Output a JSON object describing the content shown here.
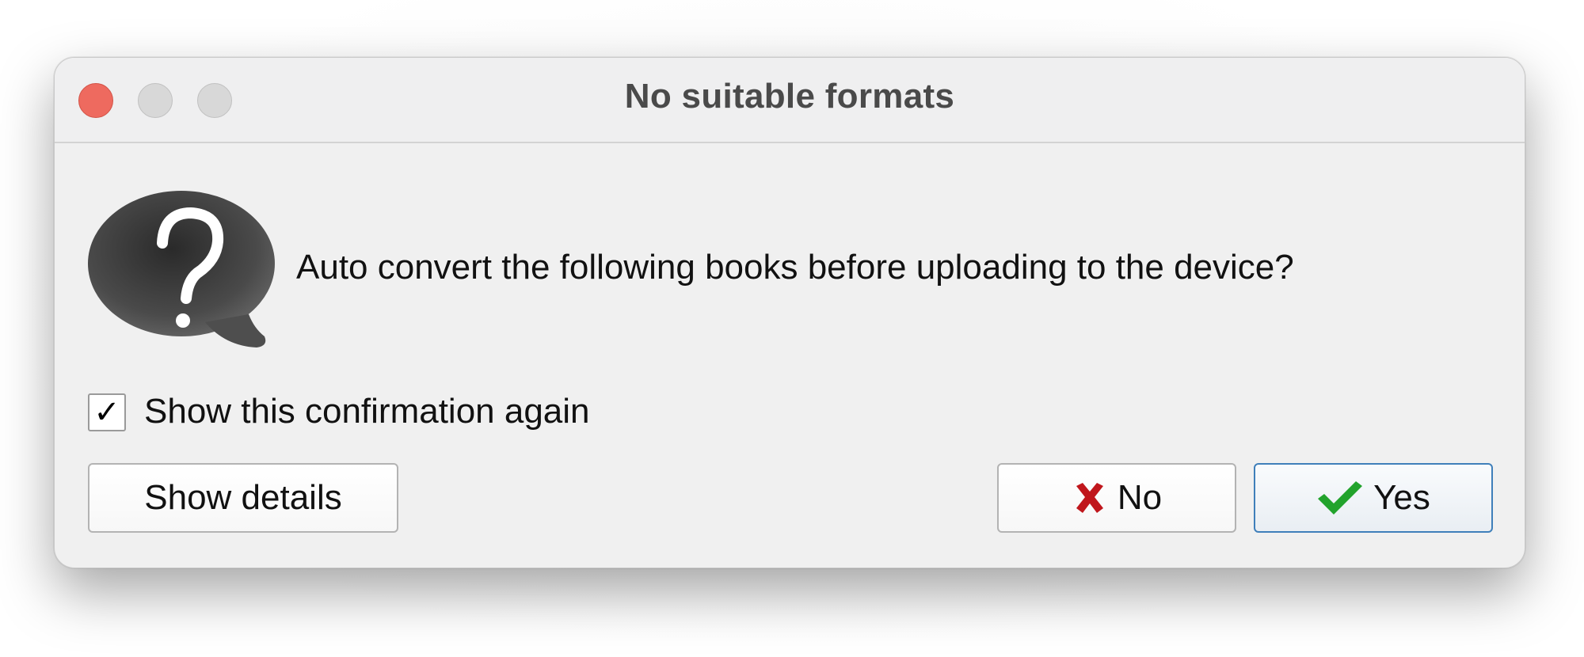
{
  "window": {
    "title": "No suitable formats"
  },
  "dialog": {
    "icon": "question-bubble-icon",
    "message": "Auto convert the following books before uploading to the device?",
    "checkbox": {
      "label": "Show this confirmation again",
      "checked": true,
      "mark": "✓"
    },
    "buttons": {
      "details": "Show details",
      "no": "No",
      "yes": "Yes"
    }
  },
  "colors": {
    "close": "#ee6a5f",
    "no_icon": "#c0161c",
    "yes_icon": "#22a32c",
    "default_button_border": "#3f7fba"
  }
}
